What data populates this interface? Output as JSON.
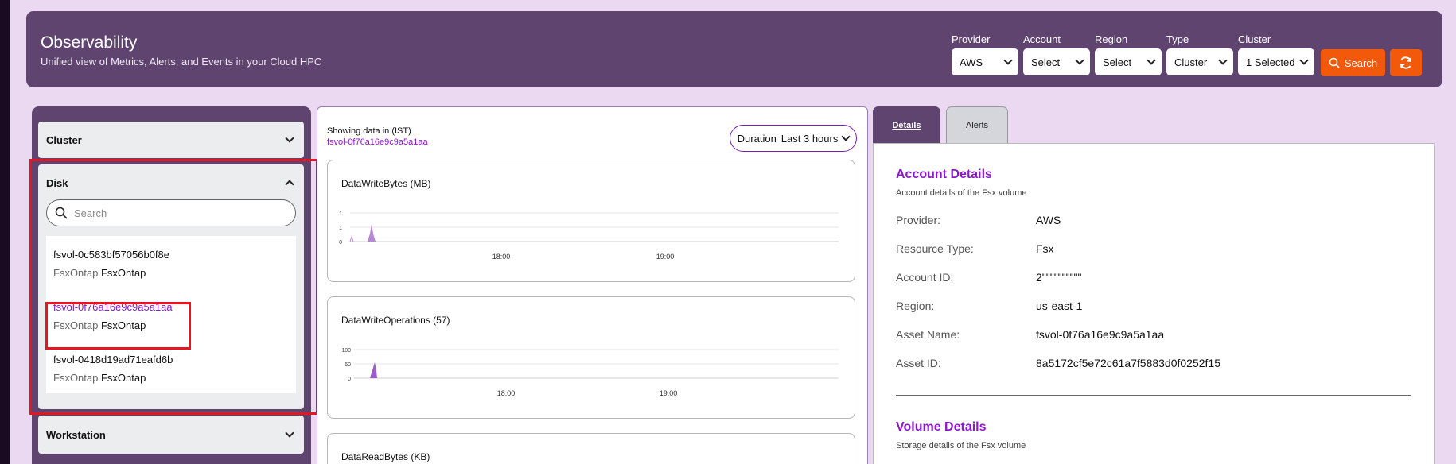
{
  "header": {
    "title": "Observability",
    "subtitle": "Unified view of Metrics, Alerts, and Events in your Cloud HPC",
    "filters": [
      {
        "label": "Provider",
        "value": "AWS"
      },
      {
        "label": "Account",
        "value": "Select"
      },
      {
        "label": "Region",
        "value": "Select"
      },
      {
        "label": "Type",
        "value": "Cluster"
      },
      {
        "label": "Cluster",
        "value": "1 Selected"
      }
    ],
    "search_label": "Search"
  },
  "sidebar": {
    "cluster_label": "Cluster",
    "disk_label": "Disk",
    "workstation_label": "Workstation",
    "search_placeholder": "Search",
    "disks": [
      {
        "name": "fsvol-0c583bf57056b0f8e",
        "type_label": "FsxOntap",
        "type_value": "FsxOntap"
      },
      {
        "name": "fsvol-0f76a16e9c9a5a1aa",
        "type_label": "FsxOntap",
        "type_value": "FsxOntap"
      },
      {
        "name": "fsvol-0418d19ad71eafd6b",
        "type_label": "FsxOntap",
        "type_value": "FsxOntap"
      }
    ]
  },
  "main": {
    "showing": "Showing data in (IST)",
    "asset": "fsvol-0f76a16e9c9a5a1aa",
    "duration_label": "Duration",
    "duration_value": "Last 3 hours",
    "charts": [
      {
        "title": "DataWriteBytes  (MB)",
        "yticks": [
          "1",
          "1",
          "0"
        ],
        "xticks": [
          "18:00",
          "19:00"
        ]
      },
      {
        "title": "DataWriteOperations  (57)",
        "yticks": [
          "100",
          "50",
          "0"
        ],
        "xticks": [
          "18:00",
          "19:00"
        ]
      },
      {
        "title": "DataReadBytes  (KB)"
      }
    ]
  },
  "details": {
    "tabs": [
      "Details",
      "Alerts"
    ],
    "account_title": "Account Details",
    "account_desc": "Account details of the Fsx volume",
    "fields": [
      {
        "k": "Provider:",
        "v": "AWS"
      },
      {
        "k": "Resource Type:",
        "v": "Fsx"
      },
      {
        "k": "Account ID:",
        "v": "2\"\"\"\"\"\"\"\"\"\""
      },
      {
        "k": "Region:",
        "v": "us-east-1"
      },
      {
        "k": "Asset Name:",
        "v": "fsvol-0f76a16e9c9a5a1aa"
      },
      {
        "k": "Asset ID:",
        "v": "8a5172cf5e72c61a7f5883d0f0252f15"
      }
    ],
    "volume_title": "Volume Details",
    "volume_desc": "Storage details of the Fsx volume"
  },
  "colors": {
    "brand_purple": "#5f4470",
    "accent_orange": "#f2590b",
    "link_purple": "#8a18c9",
    "highlight_red": "#e8141e"
  }
}
